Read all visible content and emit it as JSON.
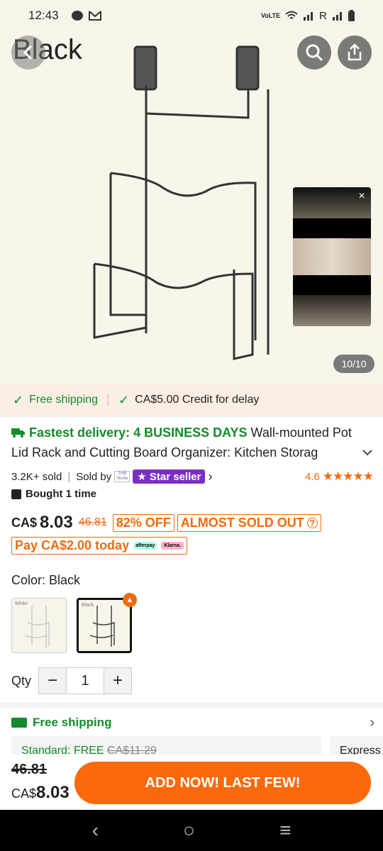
{
  "status_bar": {
    "time": "12:43",
    "indicators": [
      "chat-icon",
      "gmail-icon",
      "volte-icon",
      "wifi-icon",
      "signal-icon",
      "R",
      "signal-icon",
      "battery-icon"
    ],
    "roaming": "R"
  },
  "hero": {
    "variant_title": "Black",
    "page_indicator": "10/10",
    "video_close": "×"
  },
  "shipping_banner": {
    "free_shipping": "Free shipping",
    "credit": "CA$5.00 Credit for delay"
  },
  "product": {
    "fastest_delivery": "Fastest delivery: 4 BUSINESS DAYS",
    "title_part1": "Wall-mounted Pot",
    "title_part2": "Lid Rack and Cutting Board Organizer: Kitchen Storag",
    "sold": "3.2K+ sold",
    "sold_by": "Sold by",
    "shop_logo_text": "THB Teche",
    "star_seller": "Star seller",
    "rating": "4.6",
    "bought": "Bought 1 time"
  },
  "price": {
    "currency": "CA$",
    "current": "8.03",
    "original": "46.81",
    "discount": "82% OFF",
    "stock": "ALMOST SOLD OUT",
    "pay_today": "Pay CA$2.00 today",
    "afterpay": "afterpay",
    "klarna": "Klarna."
  },
  "color": {
    "label": "Color: Black",
    "options": [
      {
        "name": "White"
      },
      {
        "name": "Black"
      }
    ],
    "hot_icon": "flame-icon"
  },
  "quantity": {
    "label": "Qty",
    "value": "1",
    "minus": "−",
    "plus": "+"
  },
  "shipping_section": {
    "title": "Free shipping",
    "standard": "Standard: FREE",
    "standard_old": "CA$11.29",
    "express": "Express"
  },
  "action_bar": {
    "old_price": "46.81",
    "currency": "CA$",
    "price": "8.03",
    "button": "ADD NOW! LAST FEW!"
  },
  "colors": {
    "accent": "#fa6a0b",
    "green": "#138c2b",
    "star_seller": "#7b2fc2"
  }
}
